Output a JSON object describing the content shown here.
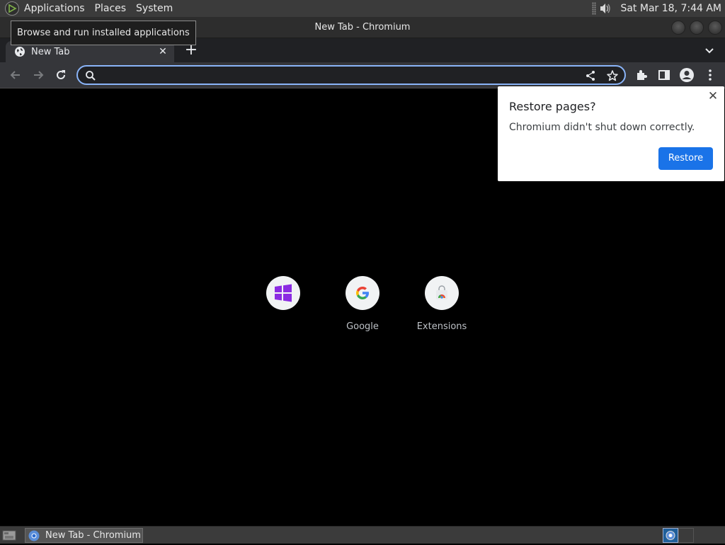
{
  "top_panel": {
    "menus": [
      "Applications",
      "Places",
      "System"
    ],
    "clock": "Sat Mar 18,  7:44 AM"
  },
  "tooltip": {
    "text": "Browse and run installed applications"
  },
  "window": {
    "title": "New Tab - Chromium"
  },
  "tabs": [
    {
      "title": "New Tab"
    }
  ],
  "omnibox": {
    "value": "",
    "placeholder": ""
  },
  "restore_popup": {
    "title": "Restore pages?",
    "message": "Chromium didn't shut down correctly.",
    "button": "Restore"
  },
  "shortcuts": [
    {
      "label": "",
      "icon": "windows-logo-icon"
    },
    {
      "label": "Google",
      "icon": "google-logo-icon"
    },
    {
      "label": "Extensions",
      "icon": "web-store-icon"
    }
  ],
  "taskbar": {
    "items": [
      {
        "title": "New Tab - Chromium"
      }
    ]
  },
  "colors": {
    "accent": "#8ab4f8",
    "restore_button": "#1a73e8",
    "tab_bg": "#35363a",
    "frame": "#202124"
  }
}
